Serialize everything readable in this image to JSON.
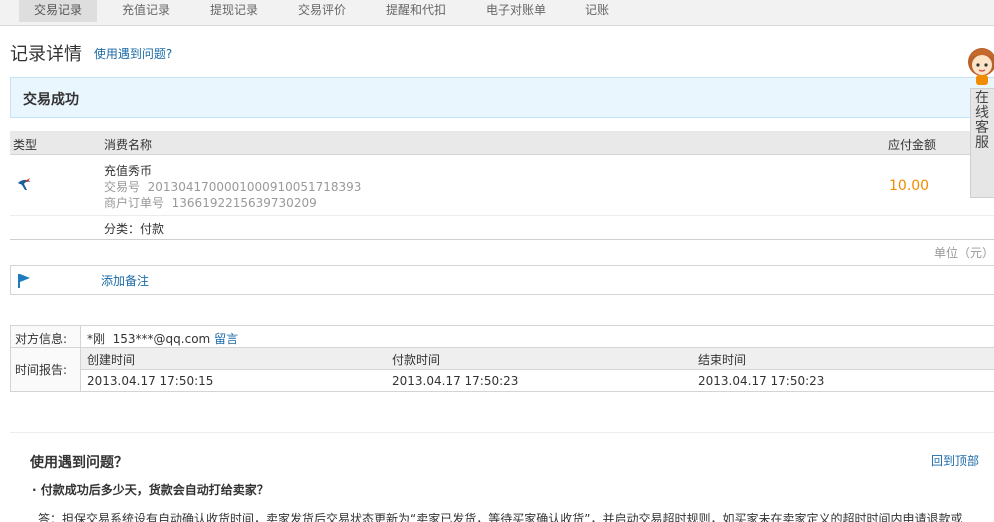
{
  "tabs": [
    "交易记录",
    "充值记录",
    "提现记录",
    "交易评价",
    "提醒和代扣",
    "电子对账单",
    "记账"
  ],
  "active_tab": "交易记录",
  "page": {
    "title": "记录详情",
    "help_link": "使用遇到问题?"
  },
  "status": {
    "text": "交易成功"
  },
  "table": {
    "headers": {
      "type": "类型",
      "name": "消费名称",
      "amount": "应付金额"
    },
    "item": {
      "icon": "swift-bird-icon",
      "name": "充值秀币",
      "trade_no_label": "交易号",
      "trade_no": "2013041700001000910051718393",
      "order_no_label": "商户订单号",
      "order_no": "1366192215639730209",
      "amount": "10.00",
      "category": "分类：付款"
    },
    "unit": "单位（元）"
  },
  "note": {
    "icon": "flag-icon",
    "add_label": "添加备注"
  },
  "info": {
    "counterpart_label": "对方信息:",
    "counterpart_name": "*刚",
    "counterpart_email": "153***@qq.com",
    "message_link": "留言",
    "time_label": "时间报告:",
    "time_headers": [
      "创建时间",
      "付款时间",
      "结束时间"
    ],
    "time_values": [
      "2013.04.17 17:50:15",
      "2013.04.17 17:50:23",
      "2013.04.17 17:50:23"
    ]
  },
  "help": {
    "title": "使用遇到问题？",
    "back_to_top": "回到顶部",
    "question": "· 付款成功后多少天，货款会自动打给卖家？",
    "answer": "答：担保交易系统设有自动确认收货时间，卖家发货后交易状态更新为“卖家已发货，等待买家确认收货”，并启动交易超时规则，如买家未在卖家定义的超时时间内申请退款或"
  },
  "service": {
    "label": "在线客服"
  },
  "colors": {
    "accent": "#1a6aa6",
    "amount": "#f08c00",
    "status_bg": "#eaf6fd"
  }
}
